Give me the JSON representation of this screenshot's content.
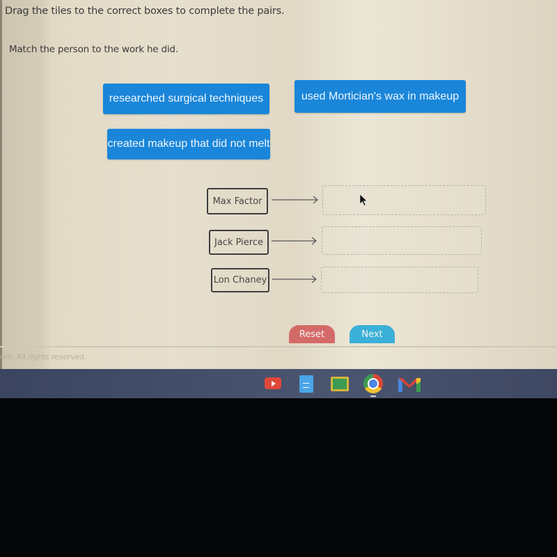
{
  "question": {
    "instruction": "Drag the tiles to the correct boxes to complete the pairs.",
    "prompt": "Match the person to the work he did."
  },
  "tiles": [
    {
      "label": "researched surgical techniques"
    },
    {
      "label": "used Mortician's wax in makeup"
    },
    {
      "label": "created makeup that did not melt"
    }
  ],
  "pairs": [
    {
      "person": "Max Factor",
      "answer": ""
    },
    {
      "person": "Jack Pierce",
      "answer": ""
    },
    {
      "person": "Lon Chaney",
      "answer": ""
    }
  ],
  "buttons": {
    "reset": "Reset",
    "next": "Next"
  },
  "footer": {
    "text": "um. All rights reserved."
  },
  "taskbar": {
    "apps": [
      "youtube-icon",
      "google-docs-icon",
      "google-classroom-icon",
      "chrome-icon",
      "gmail-icon"
    ]
  },
  "colors": {
    "tile": "#1a86d9",
    "reset": "#d46a68",
    "next": "#3ab0d8"
  }
}
